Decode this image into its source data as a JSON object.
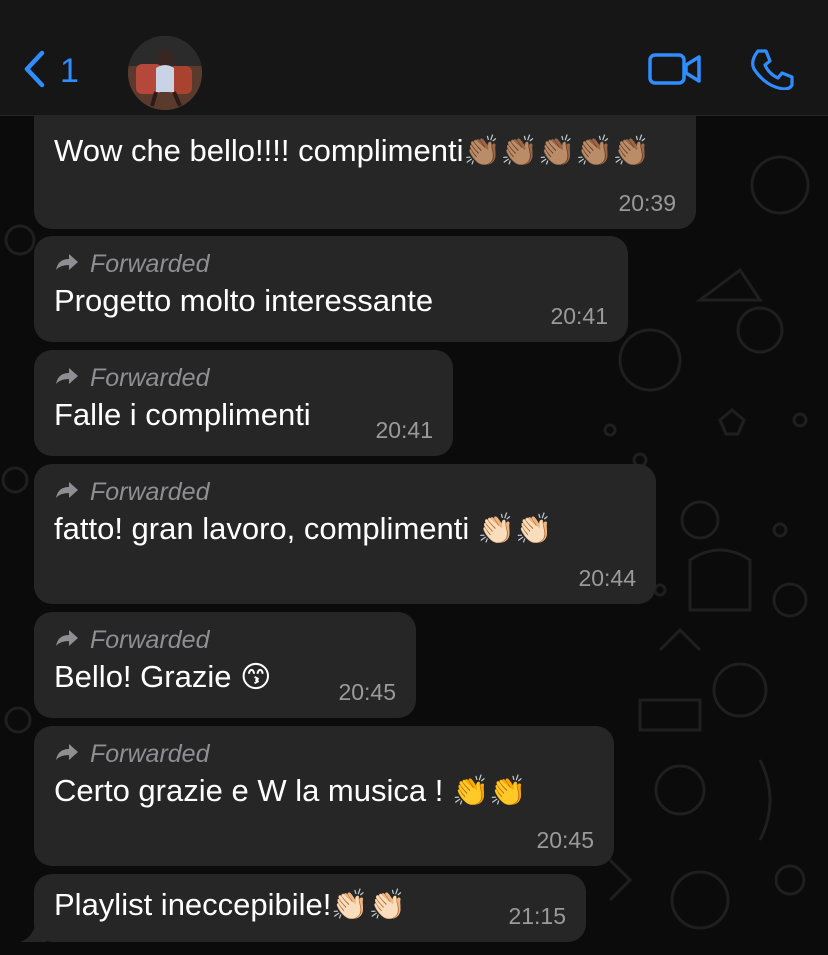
{
  "header": {
    "back_count": "1",
    "back_icon": "chevron-left-icon",
    "video_icon": "video-camera-icon",
    "call_icon": "phone-icon",
    "accent_color": "#2f8dff"
  },
  "messages": [
    {
      "text": "Wow che bello!!!! complimenti",
      "emoji": "👏🏽👏🏽👏🏽👏🏽👏🏽",
      "time": "20:39",
      "forwarded": false
    },
    {
      "forward_label": "Forwarded",
      "text": "Progetto molto interessante",
      "time": "20:41",
      "forwarded": true
    },
    {
      "forward_label": "Forwarded",
      "text": "Falle i complimenti",
      "time": "20:41",
      "forwarded": true
    },
    {
      "forward_label": "Forwarded",
      "text": "fatto! gran lavoro, complimenti",
      "emoji": "👏🏻👏🏻",
      "time": "20:44",
      "forwarded": true
    },
    {
      "forward_label": "Forwarded",
      "text": "Bello! Grazie",
      "emoji": "😙",
      "time": "20:45",
      "forwarded": true
    },
    {
      "forward_label": "Forwarded",
      "text": "Certo grazie e W la musica !",
      "emoji": "👏👏",
      "time": "20:45",
      "forwarded": true
    },
    {
      "text": "Playlist  ineccepibile!",
      "emoji": "👏🏻👏🏻",
      "time": "21:15",
      "forwarded": false
    }
  ]
}
